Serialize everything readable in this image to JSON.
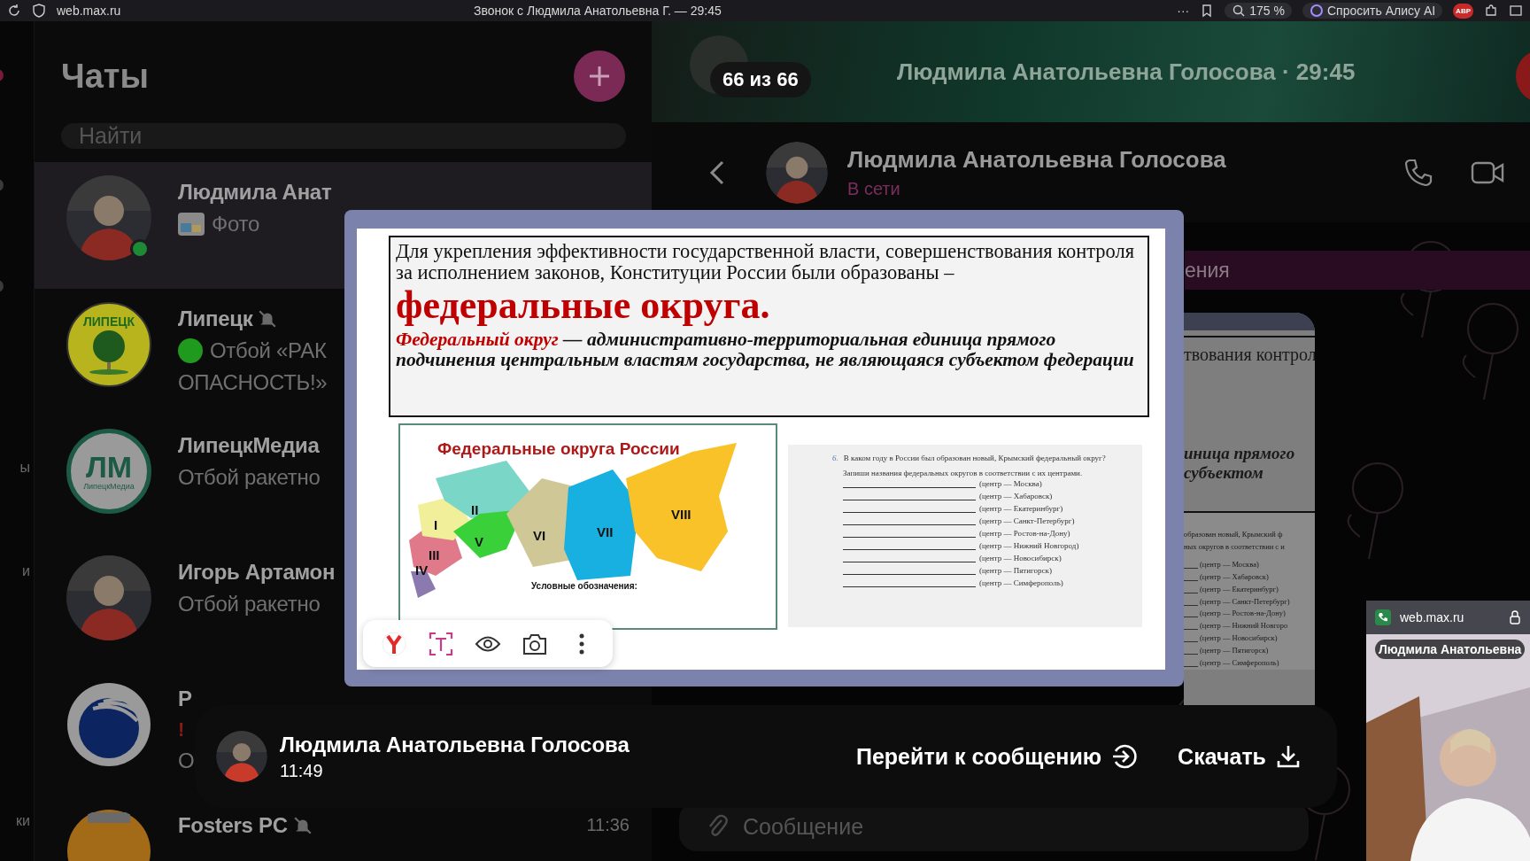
{
  "browser": {
    "url": "web.max.ru",
    "title": "Звонок с Людмила Анатольевна Г. — 29:45",
    "menu": "···",
    "zoom": "175 %",
    "assistant": "Спросить Алису AI",
    "adblock": "ABP"
  },
  "rail": {
    "labels": [
      "ы",
      "и",
      "ки"
    ]
  },
  "chats": {
    "title": "Чаты",
    "search": {
      "placeholder": "Найти"
    },
    "items": [
      {
        "name": "Людмила Анат",
        "preview": [
          "Фото"
        ],
        "attachment": true,
        "online": true,
        "muted": false,
        "selected": true,
        "avatar": {
          "kind": "person"
        }
      },
      {
        "name": "Липецк",
        "preview": [
          "Отбой «РАК",
          "ОПАСНОСТЬ!»"
        ],
        "color": "#1f9a1f",
        "muted": true,
        "selected": false,
        "avatar": {
          "kind": "tree",
          "text": "ЛИПЕЦК"
        }
      },
      {
        "name": "ЛипецкМедиа",
        "preview": [
          "Отбой ракетно"
        ],
        "muted": false,
        "selected": false,
        "avatar": {
          "kind": "monogram",
          "text": "ЛМ",
          "subtext": "ЛипецкМедиа"
        }
      },
      {
        "name": "Игорь Артамон",
        "preview": [
          "Отбой ракетно"
        ],
        "muted": false,
        "selected": false,
        "avatar": {
          "kind": "person"
        }
      },
      {
        "name": "Р",
        "alert": "!",
        "preview": [
          "О"
        ],
        "muted": false,
        "selected": false,
        "avatar": {
          "kind": "arcs"
        }
      },
      {
        "name": "Fosters PC",
        "time": "11:36",
        "muted": true,
        "selected": false,
        "avatar": {
          "kind": "orange"
        }
      }
    ]
  },
  "call_banner": {
    "counter": "66 из 66",
    "title": "Людмила Анатольевна Голосова · 29:45"
  },
  "chat_header": {
    "name": "Людмила Анатольевна Голосова",
    "status": "В сети"
  },
  "pinned": {
    "text": "ения"
  },
  "back_slide": {
    "line": "твования контрол",
    "definition_lines": [
      "иница прямого",
      "субъектом"
    ],
    "workbook_lines": [
      "образован новый, Крымский ф",
      "ных округов в соответствии с и"
    ],
    "centers": [
      "(центр — Москва)",
      "(центр — Хабаровск)",
      "(центр — Екатеринбург)",
      "(центр — Санкт-Петербург)",
      "(центр — Ростов-на-Дону)",
      "(центр — Нижний Новгоро",
      "(центр — Новосибирск)",
      "(центр — Пятигорск)",
      "(центр — Симферополь)"
    ]
  },
  "composer": {
    "placeholder": "Сообщение"
  },
  "viewer": {
    "slide": {
      "intro": "Для укрепления эффективности государственной власти, совершенствования контроля за исполнением законов, Конституции России были образованы –",
      "heading": "федеральные округа.",
      "term": "Федеральный округ",
      "definition": " — административно-территориальная единица прямого подчинения центральным властям государства, не являющаяся субъектом федерации"
    },
    "map": {
      "title": "Федеральные округа России",
      "labels": [
        "I",
        "II",
        "III",
        "IV",
        "V",
        "VI",
        "VII",
        "VIII"
      ],
      "legend": "Условные обозначения:"
    },
    "workbook": {
      "number": "6.",
      "question": "В каком году в России был образован новый, Крымский федеральный округ?",
      "task": "Запиши названия федеральных округов в соответствии с их центрами.",
      "centers": [
        "(центр — Москва)",
        "(центр — Хабаровск)",
        "(центр — Екатеринбург)",
        "(центр — Санкт-Петербург)",
        "(центр — Ростов-на-Дону)",
        "(центр — Нижний Новгород)",
        "(центр — Новосибирск)",
        "(центр — Пятигорск)",
        "(центр — Симферополь)"
      ]
    },
    "sender": {
      "name": "Людмила Анатольевна Голосова",
      "time": "11:49"
    },
    "actions": [
      {
        "label": "Перейти к сообщению",
        "kind": "goto"
      },
      {
        "label": "Скачать",
        "kind": "download"
      }
    ]
  },
  "pip": {
    "site": "web.max.ru",
    "name": "Людмила Анатольевна"
  }
}
